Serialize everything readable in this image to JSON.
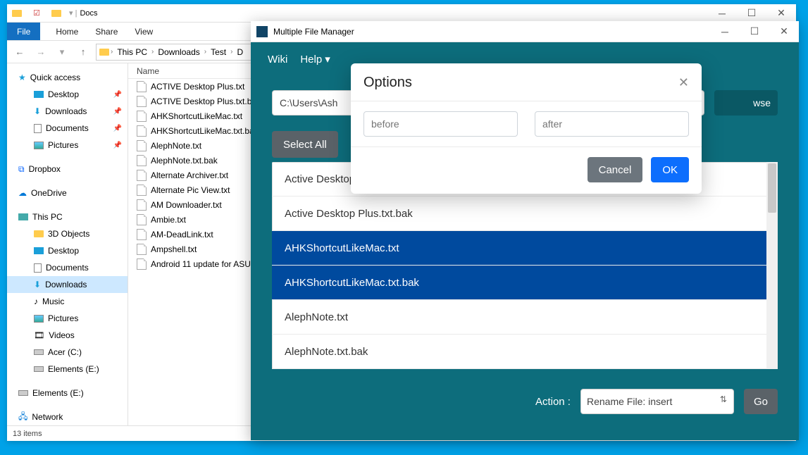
{
  "explorer": {
    "title": "Docs",
    "tabs": {
      "file": "File",
      "home": "Home",
      "share": "Share",
      "view": "View"
    },
    "crumbs": [
      "This PC",
      "Downloads",
      "Test",
      "D"
    ],
    "nav": {
      "quick": "Quick access",
      "qitems": [
        "Desktop",
        "Downloads",
        "Documents",
        "Pictures"
      ],
      "dropbox": "Dropbox",
      "onedrive": "OneDrive",
      "thispc": "This PC",
      "pcitems": [
        "3D Objects",
        "Desktop",
        "Documents",
        "Downloads",
        "Music",
        "Pictures",
        "Videos",
        "Acer (C:)",
        "Elements (E:)"
      ],
      "elements": "Elements (E:)",
      "network": "Network"
    },
    "list_header": "Name",
    "files": [
      "ACTIVE Desktop Plus.txt",
      "ACTIVE Desktop Plus.txt.ba",
      "AHKShortcutLikeMac.txt",
      "AHKShortcutLikeMac.txt.ba",
      "AlephNote.txt",
      "AlephNote.txt.bak",
      "Alternate Archiver.txt",
      "Alternate Pic View.txt",
      "AM Downloader.txt",
      "Ambie.txt",
      "AM-DeadLink.txt",
      "Ampshell.txt",
      "Android 11 update for ASU"
    ],
    "status": "13 items"
  },
  "mfm": {
    "title": "Multiple File Manager",
    "menu": {
      "wiki": "Wiki",
      "help": "Help"
    },
    "path_visible": "C:\\Users\\Ash",
    "browse": "wse",
    "select_all": "Select All",
    "files": [
      {
        "name": "Active Desktop Plus.txt",
        "selected": false
      },
      {
        "name": "Active Desktop Plus.txt.bak",
        "selected": false
      },
      {
        "name": "AHKShortcutLikeMac.txt",
        "selected": true
      },
      {
        "name": "AHKShortcutLikeMac.txt.bak",
        "selected": true
      },
      {
        "name": "AlephNote.txt",
        "selected": false
      },
      {
        "name": "AlephNote.txt.bak",
        "selected": false
      }
    ],
    "action_label": "Action :",
    "action_value": "Rename File: insert",
    "go": "Go"
  },
  "modal": {
    "title": "Options",
    "before_ph": "before",
    "after_ph": "after",
    "cancel": "Cancel",
    "ok": "OK"
  }
}
